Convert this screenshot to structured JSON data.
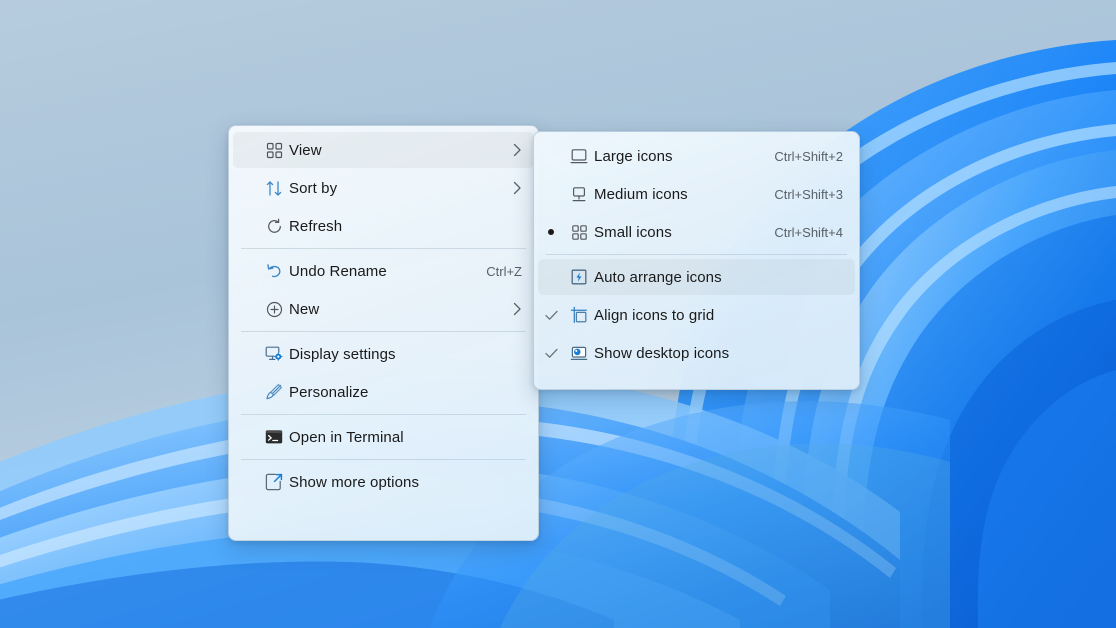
{
  "desktop": {
    "wallpaper_name": "windows-11-bloom-wallpaper",
    "sky_color": "#aac4da",
    "ribbon_colors": [
      "#0f77f0",
      "#1f86f8",
      "#3b9bfb",
      "#5fb1fd",
      "#8cc9fe",
      "#0a5fd0"
    ]
  },
  "context_menu": {
    "name": "desktop-context-menu",
    "items": [
      {
        "id": "view",
        "label": "View",
        "icon": "grid-view-icon",
        "accel": "",
        "has_submenu": true,
        "highlighted": true,
        "check": ""
      },
      {
        "id": "sort-by",
        "label": "Sort by",
        "icon": "sort-arrows-icon",
        "accel": "",
        "has_submenu": true,
        "highlighted": false,
        "check": ""
      },
      {
        "id": "refresh",
        "label": "Refresh",
        "icon": "refresh-icon",
        "accel": "",
        "has_submenu": false,
        "highlighted": false,
        "check": ""
      },
      {
        "id": "undo-rename",
        "label": "Undo Rename",
        "icon": "undo-icon",
        "accel": "Ctrl+Z",
        "has_submenu": false,
        "highlighted": false,
        "check": ""
      },
      {
        "id": "new",
        "label": "New",
        "icon": "plus-circle-icon",
        "accel": "",
        "has_submenu": true,
        "highlighted": false,
        "check": ""
      },
      {
        "id": "display-settings",
        "label": "Display settings",
        "icon": "monitor-gear-icon",
        "accel": "",
        "has_submenu": false,
        "highlighted": false,
        "check": ""
      },
      {
        "id": "personalize",
        "label": "Personalize",
        "icon": "paintbrush-icon",
        "accel": "",
        "has_submenu": false,
        "highlighted": false,
        "check": ""
      },
      {
        "id": "open-in-terminal",
        "label": "Open in Terminal",
        "icon": "terminal-icon",
        "accel": "",
        "has_submenu": false,
        "highlighted": false,
        "check": ""
      },
      {
        "id": "show-more-options",
        "label": "Show more options",
        "icon": "expand-arrow-icon",
        "accel": "",
        "has_submenu": false,
        "highlighted": false,
        "check": ""
      }
    ]
  },
  "view_submenu": {
    "name": "view-submenu",
    "items": [
      {
        "id": "large-icons",
        "label": "Large icons",
        "icon": "monitor-large-icon",
        "accel": "Ctrl+Shift+2",
        "check": "",
        "highlighted": false
      },
      {
        "id": "medium-icons",
        "label": "Medium icons",
        "icon": "monitor-medium-icon",
        "accel": "Ctrl+Shift+3",
        "check": "",
        "highlighted": false
      },
      {
        "id": "small-icons",
        "label": "Small icons",
        "icon": "grid-small-icon",
        "accel": "Ctrl+Shift+4",
        "check": "radio",
        "highlighted": false
      },
      {
        "id": "auto-arrange-icons",
        "label": "Auto arrange icons",
        "icon": "auto-arrange-icon",
        "accel": "",
        "check": "",
        "highlighted": true
      },
      {
        "id": "align-icons-to-grid",
        "label": "Align icons to grid",
        "icon": "align-grid-icon",
        "accel": "",
        "check": "checkmark",
        "highlighted": false
      },
      {
        "id": "show-desktop-icons",
        "label": "Show desktop icons",
        "icon": "desktop-icons-icon",
        "accel": "",
        "check": "checkmark",
        "highlighted": false
      }
    ]
  }
}
